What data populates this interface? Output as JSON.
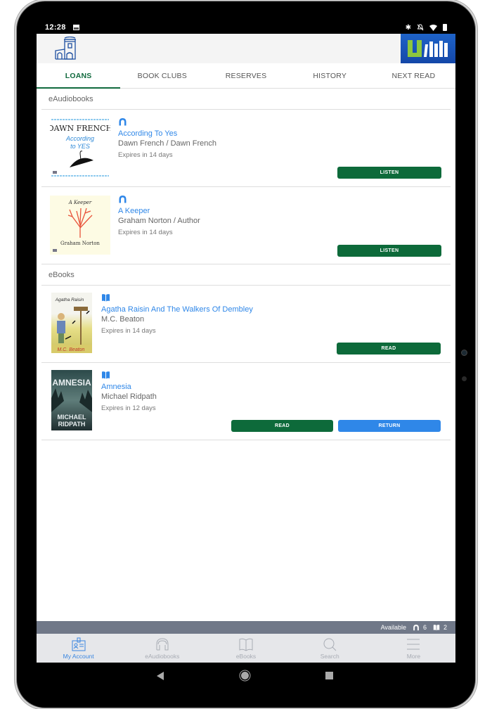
{
  "status_bar": {
    "time": "12:28",
    "icons": [
      "image-icon",
      "bluetooth-icon",
      "mute-icon",
      "wifi-icon",
      "battery-icon"
    ]
  },
  "app": {
    "left_logo": "castle-logo",
    "right_logo": "uLibrary-logo"
  },
  "tabs": [
    {
      "label": "LOANS",
      "active": true
    },
    {
      "label": "BOOK CLUBS",
      "active": false
    },
    {
      "label": "RESERVES",
      "active": false
    },
    {
      "label": "HISTORY",
      "active": false
    },
    {
      "label": "NEXT READ",
      "active": false
    }
  ],
  "sections": {
    "audiobooks": {
      "heading": "eAudiobooks",
      "items": [
        {
          "format_icon": "headphones-icon",
          "title": "According To Yes",
          "author": "Dawn French / Dawn French",
          "expires": "Expires in 14 days",
          "action": "LISTEN",
          "cover_text": [
            "DAWN FRENCH",
            "According",
            "to YES"
          ]
        },
        {
          "format_icon": "headphones-icon",
          "title": "A Keeper",
          "author": "Graham Norton / Author",
          "expires": "Expires in 14 days",
          "action": "LISTEN",
          "cover_text": [
            "A Keeper",
            "Graham Norton"
          ]
        }
      ]
    },
    "ebooks": {
      "heading": "eBooks",
      "items": [
        {
          "format_icon": "book-icon",
          "title": "Agatha Raisin And The Walkers Of Dembley",
          "author": "M.C. Beaton",
          "expires": "Expires in 14 days",
          "action": "READ",
          "cover_text": [
            "Agatha Raisin",
            "M.C. Beaton"
          ]
        },
        {
          "format_icon": "book-icon",
          "title": "Amnesia",
          "author": "Michael Ridpath",
          "expires": "Expires in 12 days",
          "action": "READ",
          "secondary_action": "RETURN",
          "cover_text": [
            "AMNESIA",
            "MICHAEL",
            "RIDPATH"
          ]
        }
      ]
    }
  },
  "availability": {
    "label": "Available",
    "audiobooks": "6",
    "ebooks": "2"
  },
  "bottom_nav": [
    {
      "label": "My Account",
      "icon": "account-card-icon",
      "active": true
    },
    {
      "label": "eAudiobooks",
      "icon": "headphones-icon",
      "active": false
    },
    {
      "label": "eBooks",
      "icon": "open-book-icon",
      "active": false
    },
    {
      "label": "Search",
      "icon": "search-icon",
      "active": false
    },
    {
      "label": "More",
      "icon": "menu-icon",
      "active": false
    }
  ],
  "colors": {
    "brand_green": "#0d6a3a",
    "link_blue": "#2f87e8",
    "avail_bar": "#707888"
  }
}
